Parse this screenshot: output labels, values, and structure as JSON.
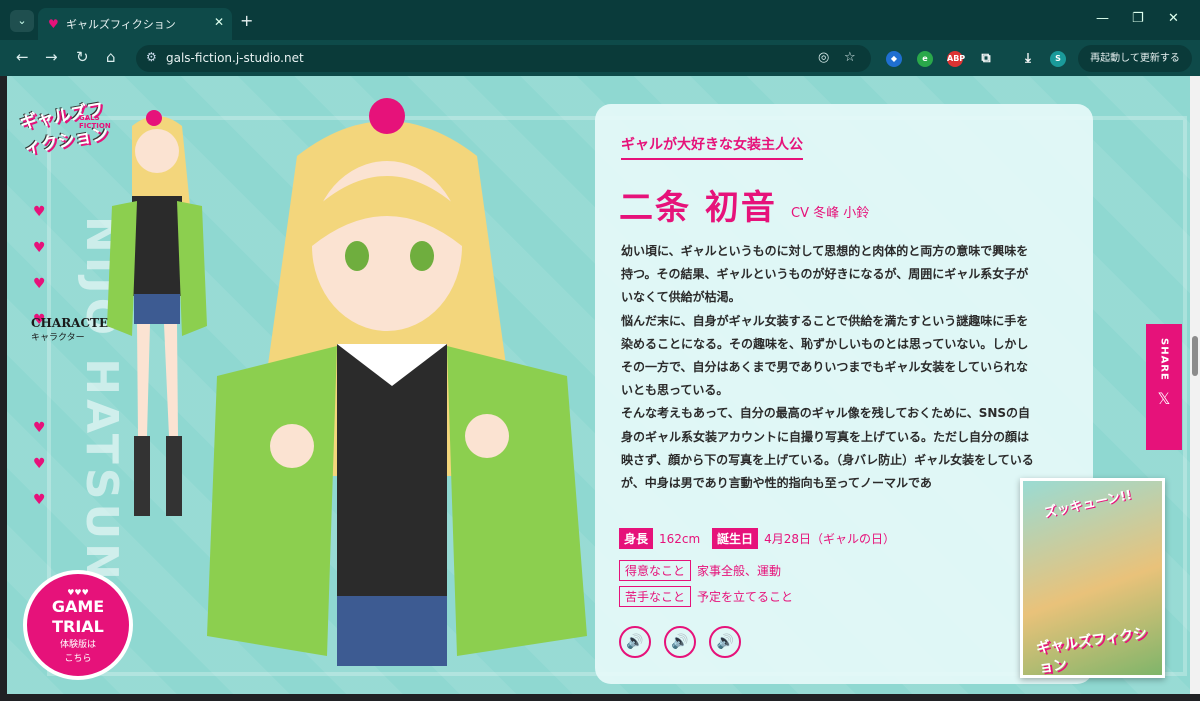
{
  "browser": {
    "tab_title": "ギャルズフィクション",
    "url": "gals-fiction.j-studio.net",
    "relaunch_label": "再起動して更新する",
    "profile_initial": "S"
  },
  "site": {
    "logo_text": "ギャルズフィクション",
    "logo_sub": "GALS FICTION",
    "nav_label_en": "CHARACTER",
    "nav_label_jp": "キャラクター",
    "vertical_name": "NIJO HATSUNE",
    "trial": {
      "title_line1": "GAME",
      "title_line2": "TRIAL",
      "sub_line1": "体験版は",
      "sub_line2": "こちら"
    },
    "share_label": "SHARE"
  },
  "character": {
    "catch": "ギャルが大好きな女装主人公",
    "name": "二条 初音",
    "cv": "CV 冬峰 小鈴",
    "bio": [
      "幼い頃に、ギャルというものに対して思想的と肉体的と両方の意味で興味を持つ。その結果、ギャルというものが好きになるが、周囲にギャル系女子がいなくて供給が枯渇。",
      "悩んだ末に、自身がギャル女装することで供給を満たすという謎趣味に手を染めることになる。その趣味を、恥ずかしいものとは思っていない。しかしその一方で、自分はあくまで男でありいつまでもギャル女装をしていられないとも思っている。",
      "そんな考えもあって、自分の最高のギャル像を残しておくために、SNSの自身のギャル系女装アカウントに自撮り写真を上げている。ただし自分の顔は映さず、顔から下の写真を上げている。（身バレ防止）ギャル女装をしているが、中身は男であり言動や性的指向も至ってノーマルであ"
    ],
    "height_label": "身長",
    "height": "162cm",
    "birthday_label": "誕生日",
    "birthday": "4月28日（ギャルの日）",
    "good_label": "得意なこと",
    "good": "家事全般、運動",
    "bad_label": "苦手なこと",
    "bad": "予定を立てること"
  },
  "thumbnail": {
    "shout": "ズッキューン!!",
    "logo": "ギャルズフィクション"
  },
  "colors": {
    "accent": "#e6127a",
    "page_bg": "#8fd8d1",
    "chrome": "#0e4a49"
  }
}
